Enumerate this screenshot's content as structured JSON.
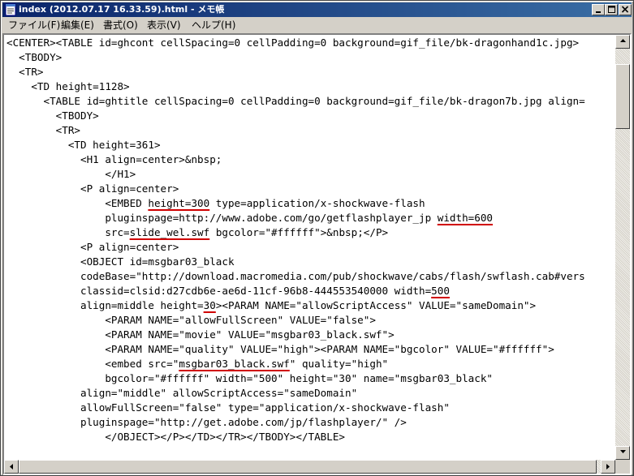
{
  "window": {
    "title": "index (2012.07.17 16.33.59).html - メモ帳",
    "icon": "notepad-icon"
  },
  "menu": {
    "items": [
      "ファイル(F)",
      "編集(E)",
      "書式(O)",
      "表示(V)",
      "ヘルプ(H)"
    ]
  },
  "editor": {
    "lines": [
      "<CENTER><TABLE id=ghcont cellSpacing=0 cellPadding=0 background=gif_file/bk-dragonhand1c.jpg>",
      "  <TBODY>",
      "  <TR>",
      "    <TD height=1128>",
      "      <TABLE id=ghtitle cellSpacing=0 cellPadding=0 background=gif_file/bk-dragon7b.jpg align=",
      "        <TBODY>",
      "        <TR>",
      "          <TD height=361>",
      "            <H1 align=center>&nbsp;",
      "                </H1>",
      "            <P align=center>",
      "                <EMBED height=300 type=application/x-shockwave-flash",
      "                pluginspage=http://www.adobe.com/go/getflashplayer_jp width=600",
      "                src=slide_wel.swf bgcolor=\"#ffffff\">&nbsp;</P>",
      "            <P align=center>",
      "            <OBJECT id=msgbar03_black",
      "            codeBase=\"http://download.macromedia.com/pub/shockwave/cabs/flash/swflash.cab#vers",
      "            classid=clsid:d27cdb6e-ae6d-11cf-96b8-444553540000 width=500",
      "            align=middle height=30><PARAM NAME=\"allowScriptAccess\" VALUE=\"sameDomain\">",
      "                <PARAM NAME=\"allowFullScreen\" VALUE=\"false\">",
      "                <PARAM NAME=\"movie\" VALUE=\"msgbar03_black.swf\">",
      "                <PARAM NAME=\"quality\" VALUE=\"high\"><PARAM NAME=\"bgcolor\" VALUE=\"#ffffff\">",
      "                <embed src=\"msgbar03_black.swf\" quality=\"high\"",
      "                bgcolor=\"#ffffff\" width=\"500\" height=\"30\" name=\"msgbar03_black\"",
      "            align=\"middle\" allowScriptAccess=\"sameDomain\"",
      "            allowFullScreen=\"false\" type=\"application/x-shockwave-flash\"",
      "            pluginspage=\"http://get.adobe.com/jp/flashplayer/\" />",
      "                </OBJECT></P></TD></TR></TBODY></TABLE>"
    ],
    "underlined": [
      "height=300",
      "width=600",
      "slide_wel.swf",
      "500",
      "30",
      "msgbar03_black.swf"
    ],
    "underline_color": "#d00000"
  },
  "colors": {
    "titlebar_start": "#0a246a",
    "titlebar_end": "#3a6ea5",
    "chrome": "#d4d0c8"
  }
}
